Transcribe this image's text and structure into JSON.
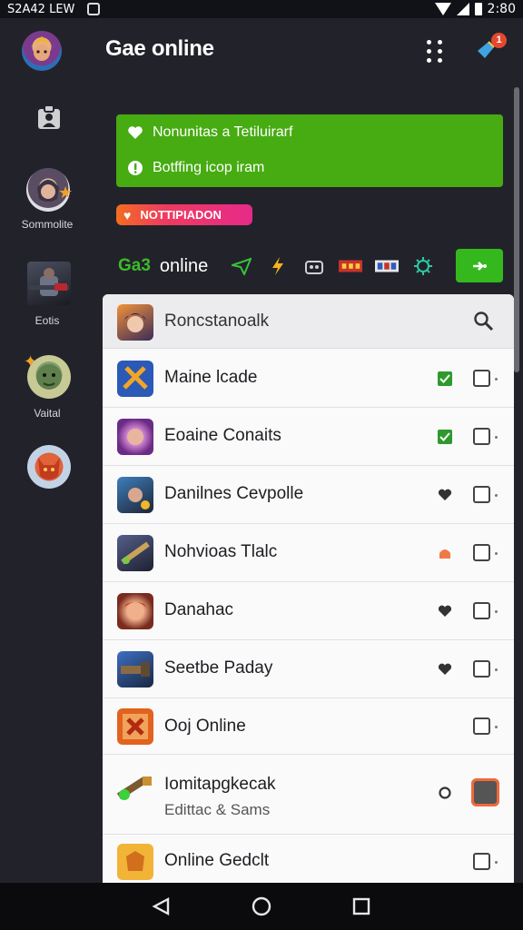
{
  "status_bar": {
    "left_text": "S2A42 LEW",
    "time": "2:80"
  },
  "header": {
    "title": "Gae online",
    "notification_count": "1"
  },
  "sidebar": {
    "items": [
      {
        "label": "",
        "icon": "hero-avatar"
      },
      {
        "label": "",
        "icon": "profile-badge-icon"
      },
      {
        "label": "Sommolite",
        "icon": "hero-avatar"
      },
      {
        "label": "Eotis",
        "icon": "warrior-avatar"
      },
      {
        "label": "Vaital",
        "icon": "goblin-avatar"
      },
      {
        "label": "",
        "icon": "demon-avatar"
      }
    ]
  },
  "notice": {
    "line1": "Nonunitas a Tetiluirarf",
    "line2": "Botffing icop iram",
    "accent": "#47ab12"
  },
  "promo_pill": {
    "label": "NOTTIPIADON"
  },
  "game_bar": {
    "tag": "Ga3",
    "word": "online",
    "icons": [
      "plane-icon",
      "lightning-icon",
      "robot-icon",
      "lca-icon",
      "ioi-icon",
      "gear-icon"
    ],
    "go_button": "go-icon"
  },
  "search": {
    "text": "Roncstanoalk"
  },
  "list": [
    {
      "name": "Maine lcade",
      "sub": "",
      "status": "checked"
    },
    {
      "name": "Eoaine Conaits",
      "sub": "",
      "status": "checked"
    },
    {
      "name": "Danilnes Cevpolle",
      "sub": "",
      "status": "heart"
    },
    {
      "name": "Nohvioas Tlalc",
      "sub": "",
      "status": "orange-flag"
    },
    {
      "name": "Danahac",
      "sub": "",
      "status": "heart"
    },
    {
      "name": "Seetbe Paday",
      "sub": "",
      "status": "heart"
    },
    {
      "name": "Ooj Online",
      "sub": "",
      "status": "none"
    },
    {
      "name": "Iomitapgkecak",
      "sub": "Edittac & Sams",
      "status": "ring"
    },
    {
      "name": "Online Gedclt",
      "sub": "",
      "status": "none"
    }
  ],
  "colors": {
    "accent_green": "#35b81e",
    "notification_red": "#e4482f",
    "background": "#22232a"
  }
}
